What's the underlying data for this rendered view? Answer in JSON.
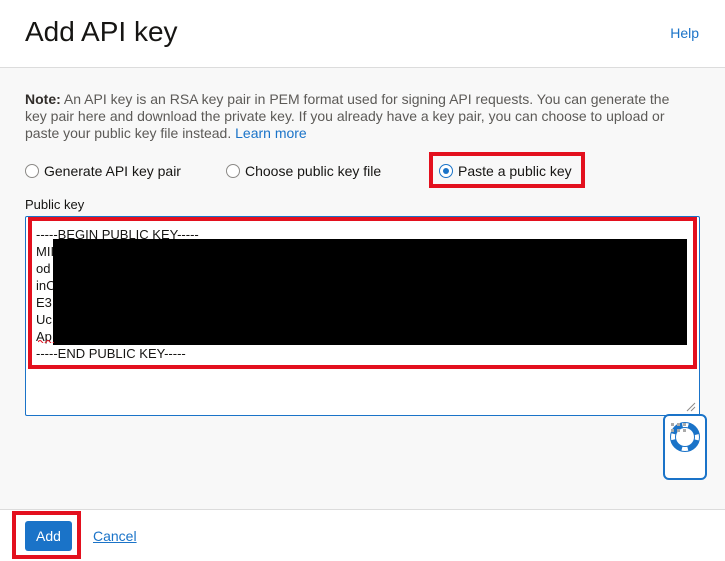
{
  "header": {
    "title": "Add API key",
    "help_label": "Help"
  },
  "note": {
    "prefix": "Note:",
    "text": " An API key is an RSA key pair in PEM format used for signing API requests. You can generate the key pair here and download the private key. If you already have a key pair, you can choose to upload or paste your public key file instead. ",
    "learn_more": "Learn more"
  },
  "options": [
    {
      "label": "Generate API key pair",
      "checked": false
    },
    {
      "label": "Choose public key file",
      "checked": false
    },
    {
      "label": "Paste a public key",
      "checked": true
    }
  ],
  "public_key": {
    "label": "Public key",
    "lines": [
      "-----BEGIN PUBLIC KEY-----",
      "MII",
      "od",
      "inC",
      "E3",
      "Uc",
      "Ap",
      "-----END PUBLIC KEY-----"
    ]
  },
  "footer": {
    "add_label": "Add",
    "cancel_label": "Cancel"
  },
  "colors": {
    "accent": "#1a73c8",
    "highlight": "#e3101e"
  },
  "icons": {
    "help_widget": "lifebuoy-icon",
    "grip": "drag-dots-icon",
    "resize": "resize-grip-icon"
  }
}
